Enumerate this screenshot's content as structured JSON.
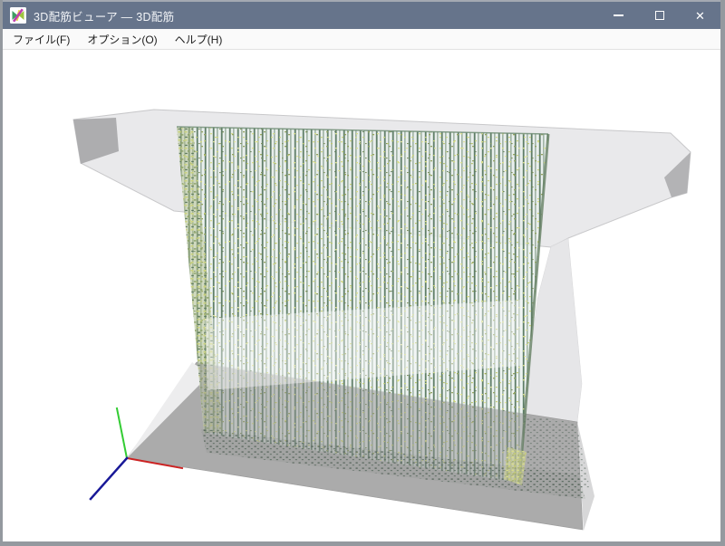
{
  "window": {
    "title": "3D配筋ビューア — 3D配筋",
    "app_icon": "rebar-viewer-app-icon",
    "controls": {
      "minimize": {
        "icon": "minimize-icon"
      },
      "maximize": {
        "icon": "maximize-icon"
      },
      "close": {
        "icon": "close-icon",
        "glyph": "✕"
      }
    }
  },
  "menu": {
    "items": [
      {
        "label": "ファイル(F)"
      },
      {
        "label": "オプション(O)"
      },
      {
        "label": "ヘルプ(H)"
      }
    ]
  },
  "viewport": {
    "content": "3D model of bridge pier: hammerhead pier cap and footing in translucent gray concrete, dense vertical rebar cage in green with yellow tie marks",
    "scene_parts": [
      "pier-cap",
      "pier-column-rebar-cage",
      "footing",
      "axis-gizmo"
    ],
    "axis_gizmo": {
      "x_color": "#cc2222",
      "y_color": "#33cc33",
      "z_color": "#191998"
    }
  },
  "colors": {
    "titlebar": "#66748b",
    "titlebar-top": "#a4a9b2",
    "win-border": "#94999f",
    "menu-bg": "#fafafa",
    "viewport-bg": "#ffffff",
    "concrete": "#e8e8ea",
    "concrete-dark": "#adadaf",
    "footing": "#ababab",
    "footing-side": "#d7d7d8",
    "rebar-green": "#5e7d66",
    "tie-yellow": "#d6dc8b",
    "axis-x": "#cc2222",
    "axis-y": "#33cc33",
    "axis-z": "#191998"
  }
}
